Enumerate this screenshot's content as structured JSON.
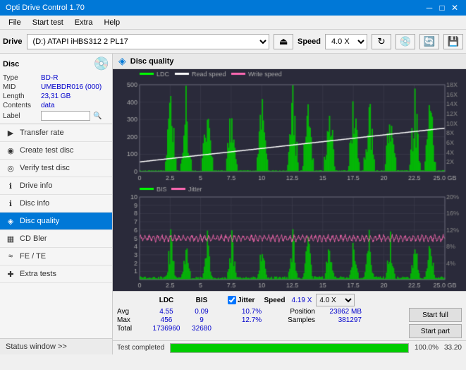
{
  "titlebar": {
    "title": "Opti Drive Control 1.70",
    "minimize": "─",
    "maximize": "□",
    "close": "✕"
  },
  "menubar": {
    "items": [
      "File",
      "Start test",
      "Extra",
      "Help"
    ]
  },
  "drivebar": {
    "label": "Drive",
    "drive_value": "(D:) ATAPI iHBS312  2 PL17",
    "speed_label": "Speed",
    "speed_value": "4.0 X"
  },
  "disc": {
    "label": "Disc",
    "type_label": "Type",
    "type_value": "BD-R",
    "mid_label": "MID",
    "mid_value": "UMEBDR016 (000)",
    "length_label": "Length",
    "length_value": "23,31 GB",
    "contents_label": "Contents",
    "contents_value": "data",
    "label_label": "Label"
  },
  "nav": {
    "items": [
      {
        "id": "transfer-rate",
        "label": "Transfer rate",
        "icon": "▶"
      },
      {
        "id": "create-test-disc",
        "label": "Create test disc",
        "icon": "◉"
      },
      {
        "id": "verify-test-disc",
        "label": "Verify test disc",
        "icon": "◎"
      },
      {
        "id": "drive-info",
        "label": "Drive info",
        "icon": "ℹ"
      },
      {
        "id": "disc-info",
        "label": "Disc info",
        "icon": "ℹ"
      },
      {
        "id": "disc-quality",
        "label": "Disc quality",
        "icon": "◈",
        "active": true
      },
      {
        "id": "cd-bler",
        "label": "CD Bler",
        "icon": "▦"
      },
      {
        "id": "fe-te",
        "label": "FE / TE",
        "icon": "≈"
      },
      {
        "id": "extra-tests",
        "label": "Extra tests",
        "icon": "✚"
      }
    ]
  },
  "status_window": "Status window >>",
  "disc_quality": {
    "title": "Disc quality",
    "legend_upper": [
      "LDC",
      "Read speed",
      "Write speed"
    ],
    "legend_lower": [
      "BIS",
      "Jitter"
    ],
    "y_axis_upper": [
      500,
      400,
      300,
      200,
      100,
      0
    ],
    "y_axis_upper_right": [
      "18X",
      "16X",
      "14X",
      "12X",
      "10X",
      "8X",
      "6X",
      "4X",
      "2X"
    ],
    "x_axis": [
      "0.0",
      "2.5",
      "5.0",
      "7.5",
      "10.0",
      "12.5",
      "15.0",
      "17.5",
      "20.0",
      "22.5",
      "25.0 GB"
    ],
    "y_axis_lower": [
      "10",
      "9",
      "8",
      "7",
      "6",
      "5",
      "4",
      "3",
      "2",
      "1"
    ],
    "y_axis_lower_right": [
      "20%",
      "16%",
      "12%",
      "8%",
      "4%"
    ]
  },
  "stats": {
    "headers": [
      "LDC",
      "BIS",
      "",
      "Jitter",
      "Speed",
      ""
    ],
    "jitter_checked": true,
    "avg_label": "Avg",
    "avg_ldc": "4.55",
    "avg_bis": "0.09",
    "avg_jitter": "10.7%",
    "avg_speed": "4.19 X",
    "max_label": "Max",
    "max_ldc": "456",
    "max_bis": "9",
    "max_jitter": "12.7%",
    "position_label": "Position",
    "position_value": "23862 MB",
    "total_label": "Total",
    "total_ldc": "1736960",
    "total_bis": "32680",
    "samples_label": "Samples",
    "samples_value": "381297",
    "speed_select": "4.0 X",
    "btn_start_full": "Start full",
    "btn_start_part": "Start part"
  },
  "progress": {
    "percent": 100,
    "bar_width_percent": 100,
    "text": "100.0%",
    "status": "Test completed",
    "value": "33.20"
  },
  "colors": {
    "ldc": "#00ff00",
    "read_speed": "#ffffff",
    "write_speed": "#ff69b4",
    "bis": "#00ff00",
    "jitter": "#ff69b4",
    "chart_bg": "#2a2a3a",
    "grid": "#444455",
    "accent": "#0078d7"
  }
}
